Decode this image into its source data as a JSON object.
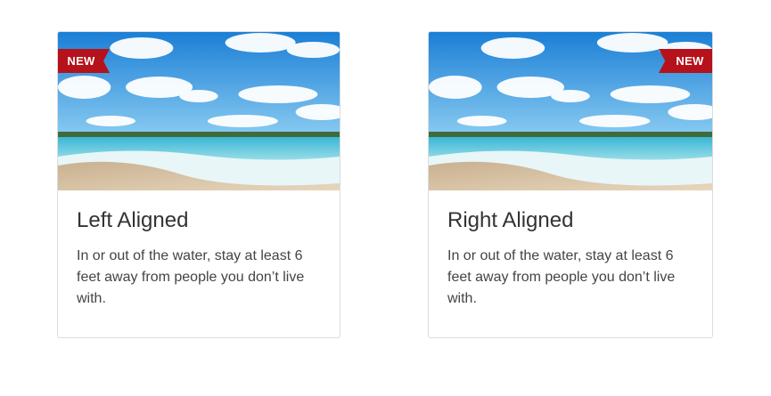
{
  "cards": [
    {
      "title": "Left Aligned",
      "text": "In or out of the water, stay at least 6 feet away from people you don’t live with.",
      "badge": "NEW"
    },
    {
      "title": "Right Aligned",
      "text": "In or out of the water, stay at least 6 feet away from people you don’t live with.",
      "badge": "NEW"
    }
  ],
  "colors": {
    "badge": "#b5121b",
    "sky": "#1e88d8",
    "sea": "#4fc3e0",
    "sand": "#d9c4a8"
  }
}
